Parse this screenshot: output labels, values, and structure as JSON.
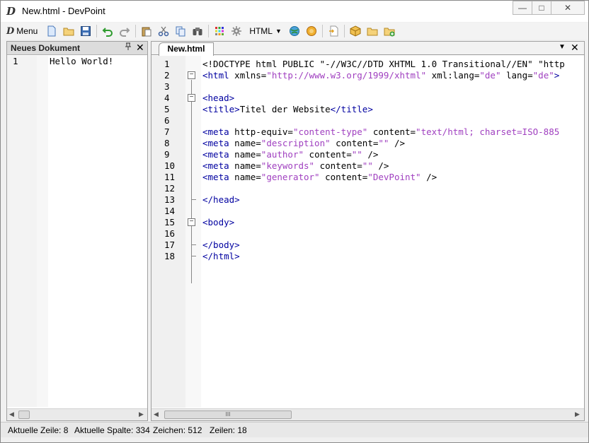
{
  "window": {
    "logo": "D",
    "title": "New.html - DevPoint",
    "minimize": "—",
    "maximize": "□",
    "close": "✕"
  },
  "toolbar": {
    "menu_logo": "D",
    "menu_label": "Menu",
    "language_select": "HTML"
  },
  "left_panel": {
    "title": "Neues Dokument",
    "pin": "ᵖ",
    "close": "✕",
    "lines": [
      {
        "number": "1",
        "text": "Hello World!"
      }
    ]
  },
  "editor": {
    "tab_label": "New.html",
    "tab_dropdown": "▼",
    "tab_close": "✕",
    "line_numbers": [
      "1",
      "2",
      "3",
      "4",
      "5",
      "6",
      "7",
      "8",
      "9",
      "10",
      "11",
      "12",
      "13",
      "14",
      "15",
      "16",
      "17",
      "18"
    ],
    "lines": [
      "<!DOCTYPE html PUBLIC \"-//W3C//DTD XHTML 1.0 Transitional//EN\" \"http",
      "<html xmlns=\"http://www.w3.org/1999/xhtml\" xml:lang=\"de\" lang=\"de\">",
      "",
      "<head>",
      "<title>Titel der Website</title>",
      "",
      "<meta http-equiv=\"content-type\" content=\"text/html; charset=ISO-885",
      "<meta name=\"description\" content=\"\" />",
      "<meta name=\"author\" content=\"\" />",
      "<meta name=\"keywords\" content=\"\" />",
      "<meta name=\"generator\" content=\"DevPoint\" />",
      "",
      "</head>",
      "",
      "<body>",
      "",
      "</body>",
      "</html>"
    ]
  },
  "scrollbars": {
    "left_arrow": "◀",
    "right_arrow": "▶",
    "grip": "III"
  },
  "status": {
    "line": "Aktuelle Zeile: 8",
    "column": "Aktuelle Spalte: 334",
    "chars": "Zeichen: 512",
    "lines": "Zeilen: 18"
  }
}
